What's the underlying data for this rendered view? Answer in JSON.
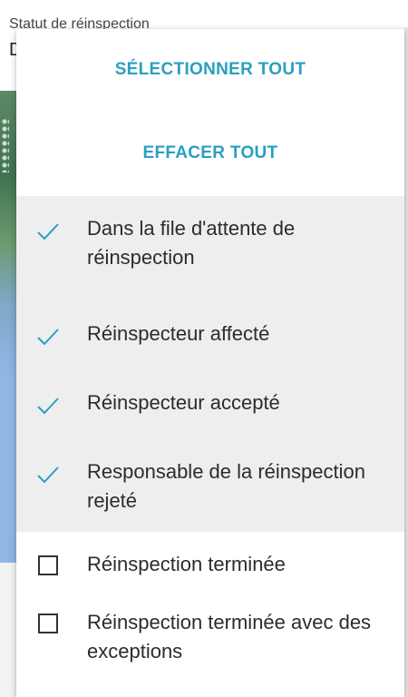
{
  "field": {
    "label": "Statut de réinspection",
    "value": "D"
  },
  "dropdown": {
    "select_all_label": "SÉLECTIONNER TOUT",
    "clear_all_label": "EFFACER TOUT",
    "options": [
      {
        "label": "Dans la file d'attente de réinspection",
        "checked": true
      },
      {
        "label": "Réinspecteur affecté",
        "checked": true
      },
      {
        "label": "Réinspecteur accepté",
        "checked": true
      },
      {
        "label": "Responsable de la réinspection rejeté",
        "checked": true
      },
      {
        "label": "Réinspection terminée",
        "checked": false
      },
      {
        "label": "Réinspection terminée avec des exceptions",
        "checked": false
      }
    ]
  },
  "colors": {
    "accent": "#2a9fbf",
    "selected_bg": "#eeeeee",
    "text": "#2c2c2c"
  },
  "icons": {
    "checked": "checkmark-icon",
    "unchecked": "checkbox-empty-icon"
  }
}
